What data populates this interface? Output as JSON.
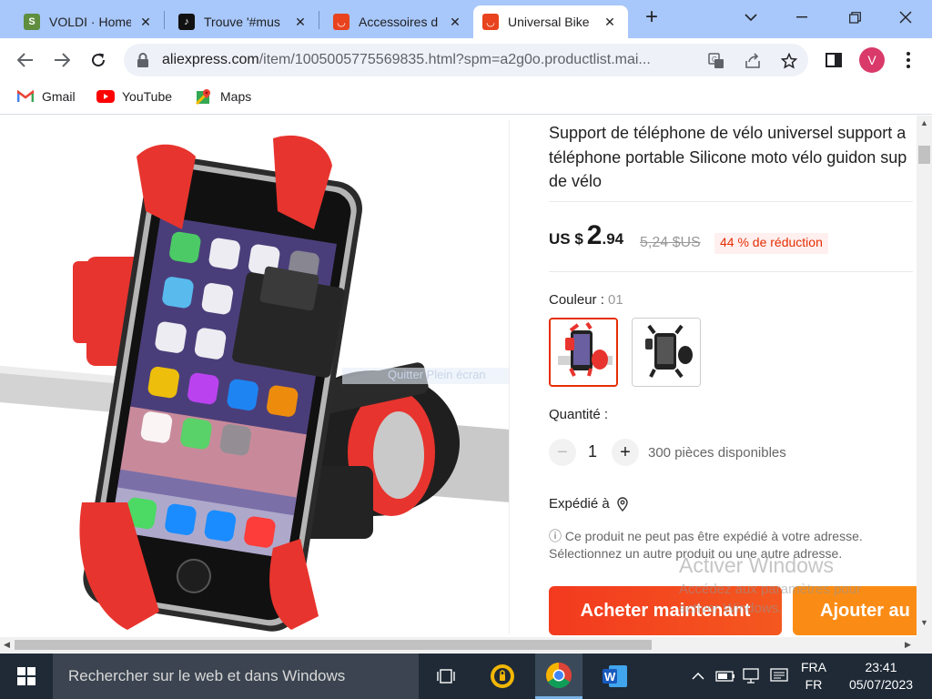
{
  "browser": {
    "tabs": [
      {
        "title": "VOLDI · Home",
        "favicon": "shopify-icon",
        "active": false
      },
      {
        "title": "Trouve '#mus",
        "favicon": "tiktok-icon",
        "active": false
      },
      {
        "title": "Accessoires d",
        "favicon": "aliexpress-icon",
        "active": false
      },
      {
        "title": "Universal Bike",
        "favicon": "aliexpress-icon",
        "active": true
      }
    ],
    "new_tab": "+",
    "url_domain": "aliexpress.com",
    "url_path": "/item/1005005775569835.html?spm=a2g0o.productlist.mai...",
    "profile_initial": "V",
    "bookmarks": [
      {
        "label": "Gmail",
        "icon": "gmail-icon"
      },
      {
        "label": "YouTube",
        "icon": "youtube-icon"
      },
      {
        "label": "Maps",
        "icon": "maps-icon"
      }
    ]
  },
  "product": {
    "title_lines": [
      "Support de téléphone de vélo universel support a",
      "téléphone portable Silicone moto vélo guidon sup",
      "de vélo"
    ],
    "price": {
      "currency": "US $",
      "whole": "2",
      "decimal": ".94"
    },
    "old_price": "5,24 $US",
    "discount": "44 % de réduction",
    "color_label": "Couleur : ",
    "color_value": "01",
    "quantity_label": "Quantité :",
    "quantity": "1",
    "qty_minus": "−",
    "qty_plus": "+",
    "stock": "300 pièces disponibles",
    "ship_label": "Expédié à",
    "ship_note_1": "Ce produit ne peut pas être expédié à votre adresse.",
    "ship_note_2": "Sélectionnez un autre produit ou une autre adresse.",
    "info_glyph": "ⓘ",
    "buy_now": "Acheter maintenant",
    "add_to_cart": "Ajouter au",
    "image_hint": "Quitter Plein écran"
  },
  "watermark": {
    "line1": "Activer Windows",
    "line2": "Accédez aux paramètres pour",
    "line3": "activer Windows."
  },
  "taskbar": {
    "search_placeholder": "Rechercher sur le web et dans Windows",
    "lang_1": "FRA",
    "lang_2": "FR",
    "time": "23:41",
    "date": "05/07/2023"
  },
  "colors": {
    "accent": "#e62e04",
    "buy": "#f33a1f",
    "cart": "#fa8c16",
    "tabstrip": "#a8c7fa"
  }
}
